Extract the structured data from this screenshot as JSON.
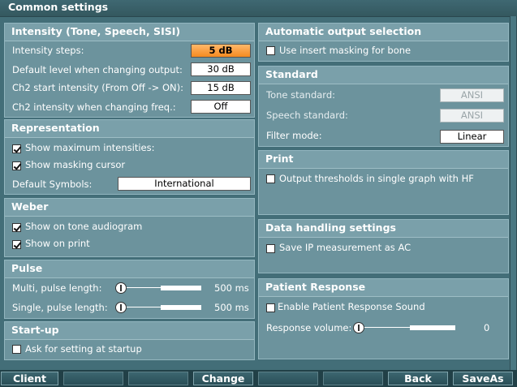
{
  "window": {
    "title": "Common settings"
  },
  "intensity": {
    "title": "Intensity (Tone, Speech, SISI)",
    "rows": [
      {
        "label": "Intensity steps:",
        "value": "5 dB"
      },
      {
        "label": "Default level when changing output:",
        "value": "30 dB"
      },
      {
        "label": "Ch2 start intensity (From Off -> ON):",
        "value": "15 dB"
      },
      {
        "label": "Ch2 intensity when changing freq.:",
        "value": "Off"
      }
    ]
  },
  "representation": {
    "title": "Representation",
    "show_max_label": "Show maximum intensities:",
    "show_masking_label": "Show masking cursor",
    "default_symbols_label": "Default Symbols:",
    "default_symbols_value": "International"
  },
  "weber": {
    "title": "Weber",
    "tone_label": "Show on tone audiogram",
    "print_label": "Show on print"
  },
  "pulse": {
    "title": "Pulse",
    "multi_label": "Multi, pulse length:",
    "multi_value": "500 ms",
    "single_label": "Single, pulse length:",
    "single_value": "500 ms"
  },
  "startup": {
    "title": "Start-up",
    "ask_label": "Ask for setting at startup"
  },
  "auto_output": {
    "title": "Automatic output selection",
    "insert_label": "Use insert masking for bone"
  },
  "standard": {
    "title": "Standard",
    "tone_label": "Tone standard:",
    "tone_value": "ANSI",
    "speech_label": "Speech standard:",
    "speech_value": "ANSI",
    "filter_label": "Filter mode:",
    "filter_value": "Linear"
  },
  "print": {
    "title": "Print",
    "output_label": "Output thresholds in single graph with HF"
  },
  "data_handling": {
    "title": "Data handling settings",
    "ip_label": "Save IP measurement as AC"
  },
  "patient_response": {
    "title": "Patient Response",
    "enable_label": "Enable Patient Response Sound",
    "volume_label": "Response volume:",
    "volume_value": "0"
  },
  "toolbar": {
    "client": "Client",
    "change": "Change",
    "back": "Back",
    "saveas": "SaveAs"
  }
}
